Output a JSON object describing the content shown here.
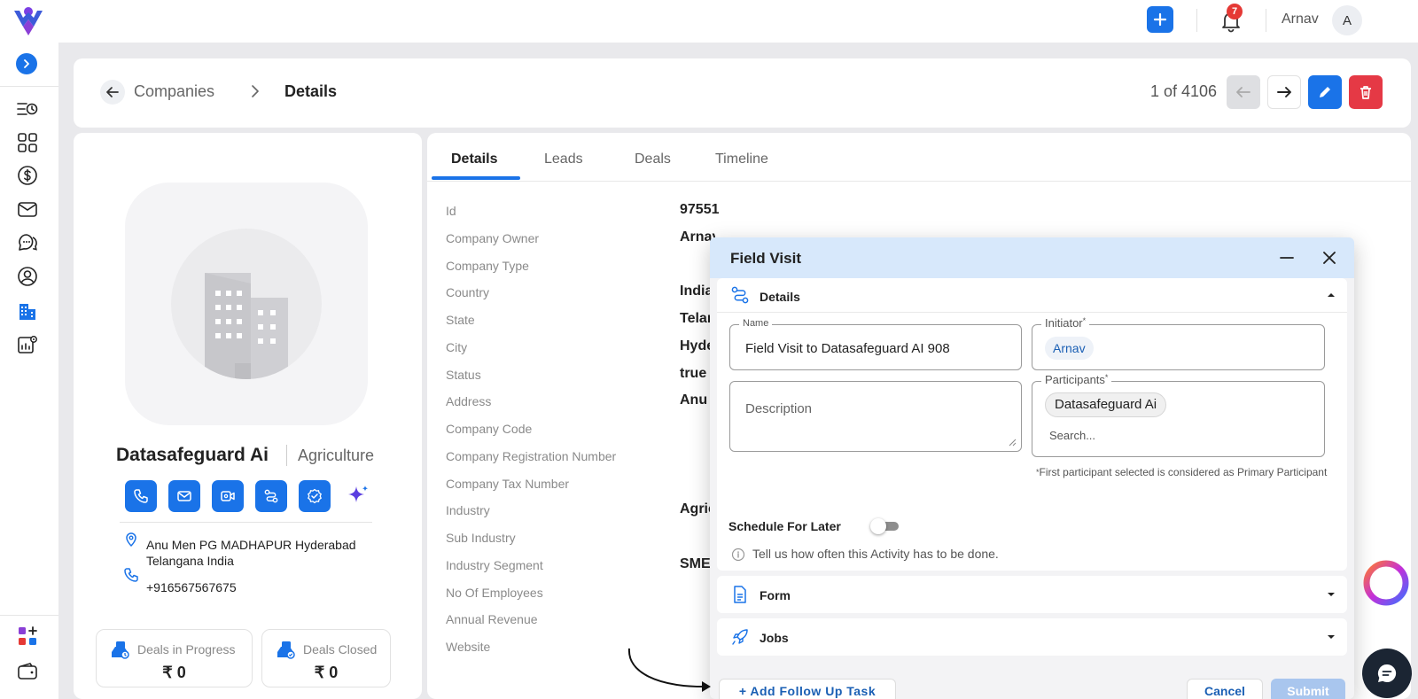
{
  "topbar": {
    "notification_count": "7",
    "user_name": "Arnav",
    "user_initial": "A"
  },
  "header": {
    "crumb_parent": "Companies",
    "crumb_current": "Details",
    "pager": "1 of 4106"
  },
  "profile": {
    "name": "Datasafeguard Ai",
    "industry": "Agriculture",
    "address": "Anu Men PG MADHAPUR Hyderabad Telangana India",
    "phone": "+916567567675",
    "deals_in_progress_label": "Deals in Progress",
    "deals_in_progress_value": "₹ 0",
    "deals_closed_label": "Deals Closed",
    "deals_closed_value": "₹ 0"
  },
  "tabs": [
    "Details",
    "Leads",
    "Deals",
    "Timeline"
  ],
  "fields": [
    {
      "label": "Id",
      "value": "97551"
    },
    {
      "label": "Company Owner",
      "value": "Arnav"
    },
    {
      "label": "Company Type",
      "value": ""
    },
    {
      "label": "Country",
      "value": "India"
    },
    {
      "label": "State",
      "value": "Telangana"
    },
    {
      "label": "City",
      "value": "Hyderabad"
    },
    {
      "label": "Status",
      "value": "true"
    },
    {
      "label": "Address",
      "value": "Anu"
    },
    {
      "label": "Company Code",
      "value": ""
    },
    {
      "label": "Company Registration Number",
      "value": ""
    },
    {
      "label": "Company Tax Number",
      "value": ""
    },
    {
      "label": "Industry",
      "value": "Agriculture"
    },
    {
      "label": "Sub Industry",
      "value": ""
    },
    {
      "label": "Industry Segment",
      "value": "SME"
    },
    {
      "label": "No Of Employees",
      "value": ""
    },
    {
      "label": "Annual Revenue",
      "value": ""
    },
    {
      "label": "Website",
      "value": ""
    }
  ],
  "modal": {
    "title": "Field Visit",
    "details_section": "Details",
    "name_legend": "Name",
    "name_value": "Field Visit to Datasafeguard AI 908",
    "initiator_legend": "Initiator",
    "initiator_value": "Arnav",
    "description_placeholder": "Description",
    "participants_legend": "Participants",
    "participant_chip": "Datasafeguard Ai",
    "search_placeholder": "Search...",
    "hint": "First participant selected is considered as Primary Participant",
    "schedule_label": "Schedule For Later",
    "info_text": "Tell us how often this Activity has to be done.",
    "form_section": "Form",
    "jobs_section": "Jobs",
    "add_follow_up": "+ Add Follow Up Task",
    "cancel": "Cancel",
    "submit": "Submit"
  },
  "colors": {
    "primary": "#1a73e8",
    "danger": "#e53945",
    "modal_header": "#d7e8fb"
  }
}
